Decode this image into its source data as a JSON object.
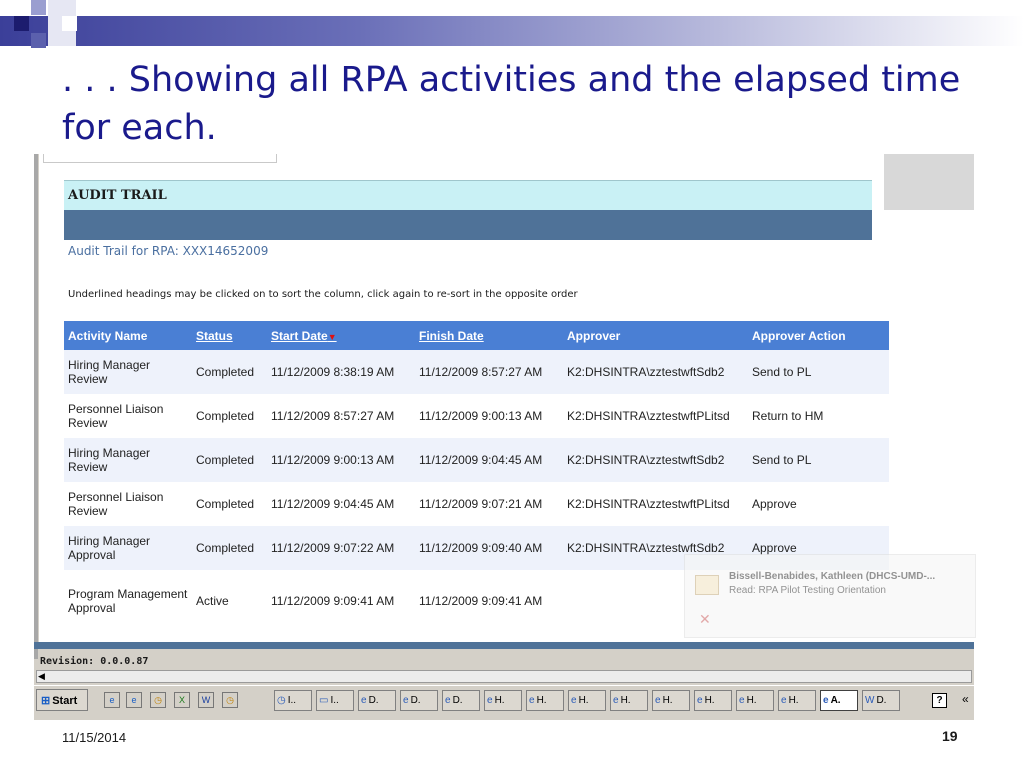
{
  "slide": {
    "title": ". . . Showing all RPA activities and the elapsed time for each.",
    "date": "11/15/2014",
    "page": "19"
  },
  "audit": {
    "header": "AUDIT TRAIL",
    "subtitle": "Audit Trail for RPA: XXX14652009",
    "hint": "Underlined headings may be clicked on to sort the column, click again to re-sort in the opposite order",
    "columns": [
      "Activity Name",
      "Status",
      "Start Date",
      "Finish Date",
      "Approver",
      "Approver Action"
    ],
    "sort_arrow": "▼",
    "rows": [
      [
        "Hiring Manager Review",
        "Completed",
        "11/12/2009 8:38:19 AM",
        "11/12/2009 8:57:27 AM",
        "K2:DHSINTRA\\zztestwftSdb2",
        "Send to PL"
      ],
      [
        "Personnel Liaison Review",
        "Completed",
        "11/12/2009 8:57:27 AM",
        "11/12/2009 9:00:13 AM",
        "K2:DHSINTRA\\zztestwftPLitsd",
        "Return to HM"
      ],
      [
        "Hiring Manager Review",
        "Completed",
        "11/12/2009 9:00:13 AM",
        "11/12/2009 9:04:45 AM",
        "K2:DHSINTRA\\zztestwftSdb2",
        "Send to PL"
      ],
      [
        "Personnel Liaison Review",
        "Completed",
        "11/12/2009 9:04:45 AM",
        "11/12/2009 9:07:21 AM",
        "K2:DHSINTRA\\zztestwftPLitsd",
        "Approve"
      ],
      [
        "Hiring Manager Approval",
        "Completed",
        "11/12/2009 9:07:22 AM",
        "11/12/2009 9:09:40 AM",
        "K2:DHSINTRA\\zztestwftSdb2",
        "Approve"
      ],
      [
        "Program Management Approval",
        "Active",
        "11/12/2009 9:09:41 AM",
        "11/12/2009 9:09:41 AM",
        "",
        ""
      ]
    ],
    "revision": "Revision: 0.0.0.87"
  },
  "notification": {
    "name": "Bissell-Benabides, Kathleen (DHCS-UMD-...",
    "line": "Read: RPA Pilot Testing Orientation",
    "close": "✕"
  },
  "taskbar": {
    "start_label": "Start",
    "buttons": [
      "I..",
      "I..",
      "D.",
      "D.",
      "D.",
      "H.",
      "H.",
      "H.",
      "H.",
      "H.",
      "H.",
      "H.",
      "H.",
      "A.",
      "D."
    ],
    "active_index": 13,
    "tray_help": "?",
    "tray_more": "«"
  },
  "colors": {
    "title": "#1a1a8c",
    "header_blue": "#4a7fd4",
    "band": "#4f7298",
    "audit_header_bg": "#c9f1f5"
  }
}
